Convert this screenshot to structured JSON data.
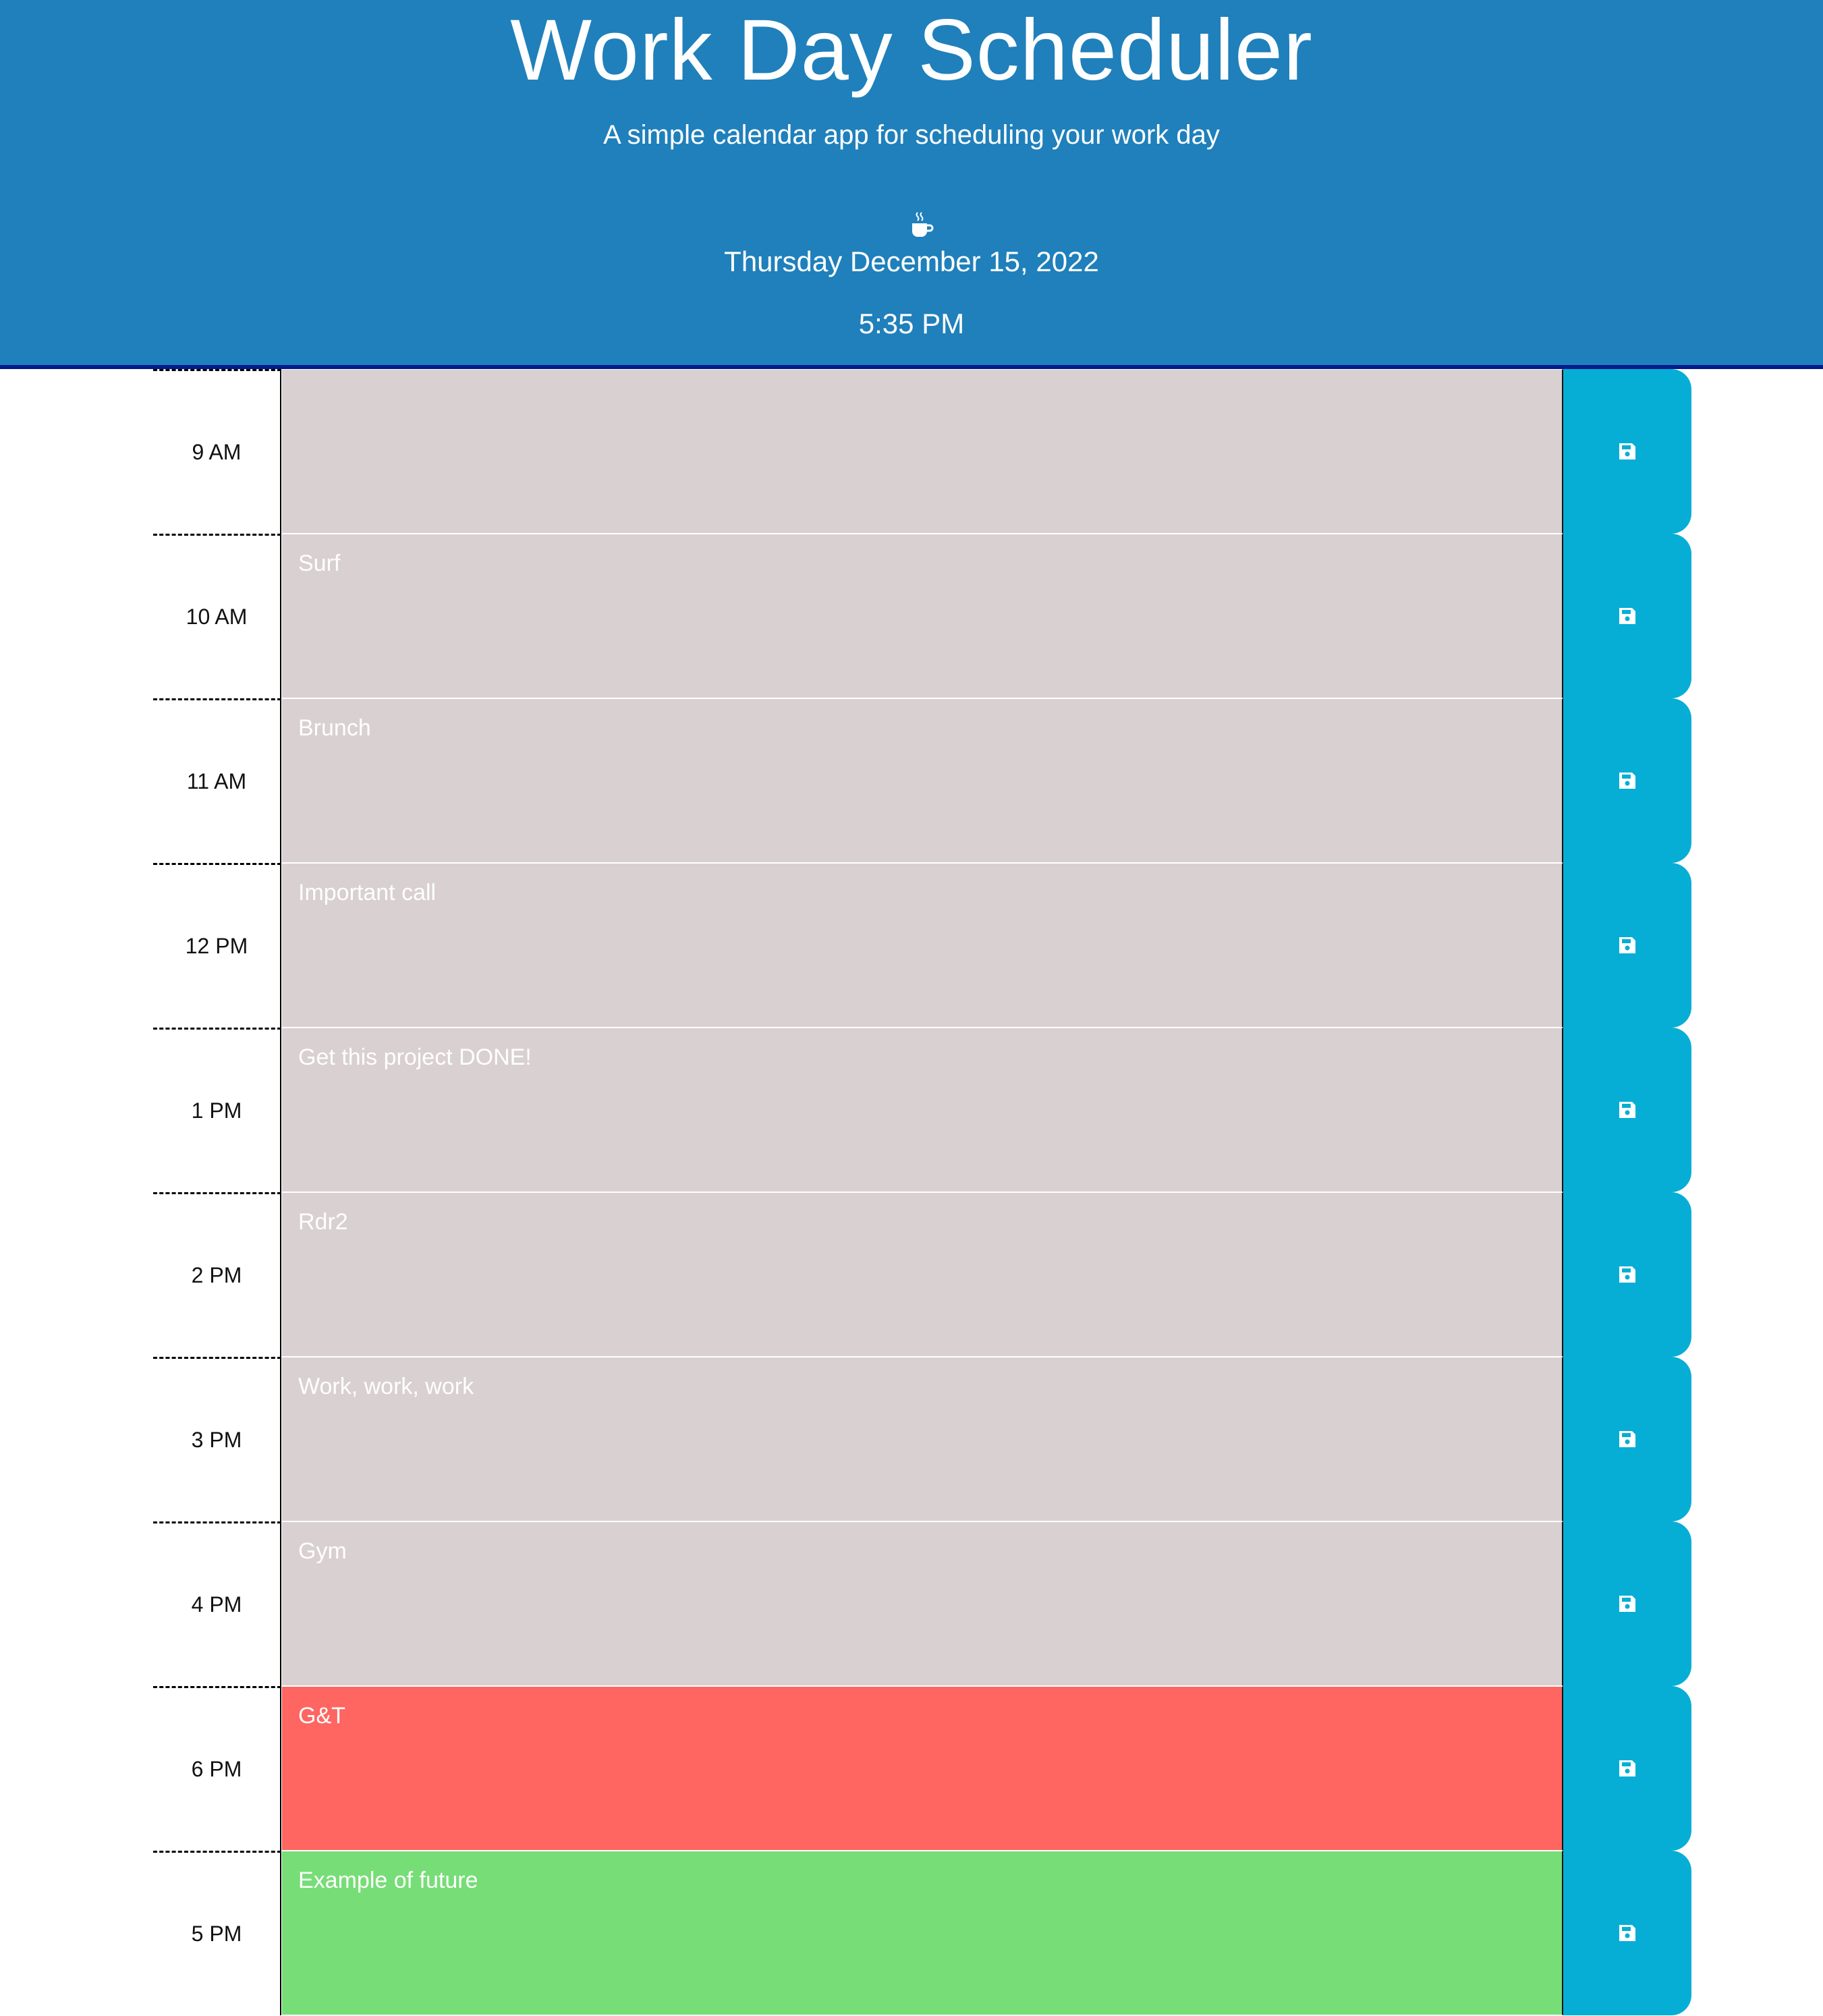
{
  "header": {
    "title": "Work Day Scheduler",
    "subtitle": "A simple calendar app for scheduling your work day",
    "icon": "coffee-icon",
    "date": "Thursday December 15, 2022",
    "time": "5:35 PM"
  },
  "colors": {
    "header_bg": "#1f80bb",
    "past": "#d9d0d1",
    "present": "#ff6661",
    "future": "#77dd77",
    "save_button": "#06aed5"
  },
  "rows": [
    {
      "hour": "9 AM",
      "text": "",
      "state": "past",
      "save_icon": "save-icon"
    },
    {
      "hour": "10 AM",
      "text": "Surf",
      "state": "past",
      "save_icon": "save-icon"
    },
    {
      "hour": "11 AM",
      "text": "Brunch",
      "state": "past",
      "save_icon": "save-icon"
    },
    {
      "hour": "12 PM",
      "text": "Important call",
      "state": "past",
      "save_icon": "save-icon"
    },
    {
      "hour": "1 PM",
      "text": "Get this project DONE!",
      "state": "past",
      "save_icon": "save-icon"
    },
    {
      "hour": "2 PM",
      "text": "Rdr2",
      "state": "past",
      "save_icon": "save-icon"
    },
    {
      "hour": "3 PM",
      "text": "Work, work, work",
      "state": "past",
      "save_icon": "save-icon"
    },
    {
      "hour": "4 PM",
      "text": "Gym",
      "state": "past",
      "save_icon": "save-icon"
    },
    {
      "hour": "6 PM",
      "text": "G&T",
      "state": "present",
      "save_icon": "save-icon"
    },
    {
      "hour": "5 PM",
      "text": "Example of future",
      "state": "future",
      "save_icon": "save-icon"
    }
  ]
}
